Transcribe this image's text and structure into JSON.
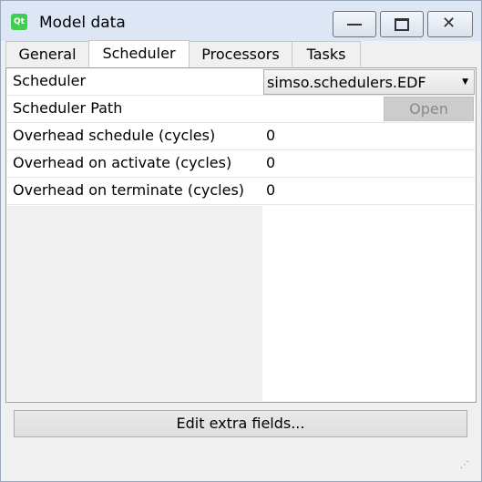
{
  "window": {
    "app_icon_text": "Qt",
    "title": "Model data",
    "controls": {
      "minimize": "—",
      "maximize": "☐",
      "close": "✕"
    }
  },
  "tabs": [
    {
      "label": "General",
      "active": false
    },
    {
      "label": "Scheduler",
      "active": true
    },
    {
      "label": "Processors",
      "active": false
    },
    {
      "label": "Tasks",
      "active": false
    }
  ],
  "scheduler_panel": {
    "scheduler": {
      "label": "Scheduler",
      "value": "simso.schedulers.EDF"
    },
    "scheduler_path": {
      "label": "Scheduler Path",
      "value": "",
      "button": "Open"
    },
    "overhead_schedule": {
      "label": "Overhead schedule (cycles)",
      "value": "0"
    },
    "overhead_activate": {
      "label": "Overhead on activate (cycles)",
      "value": "0"
    },
    "overhead_terminate": {
      "label": "Overhead on terminate (cycles)",
      "value": "0"
    }
  },
  "footer": {
    "edit_extra_fields": "Edit extra fields...",
    "grip": "⋰"
  }
}
